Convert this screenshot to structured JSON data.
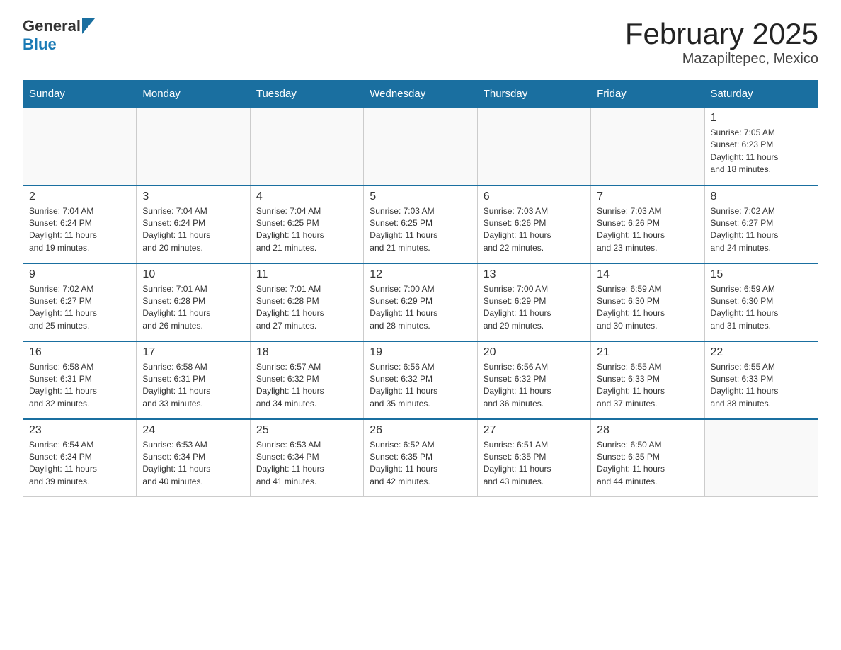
{
  "logo": {
    "general": "General",
    "blue": "Blue"
  },
  "title": "February 2025",
  "subtitle": "Mazapiltepec, Mexico",
  "days_of_week": [
    "Sunday",
    "Monday",
    "Tuesday",
    "Wednesday",
    "Thursday",
    "Friday",
    "Saturday"
  ],
  "weeks": [
    {
      "days": [
        {
          "number": "",
          "info": "",
          "empty": true
        },
        {
          "number": "",
          "info": "",
          "empty": true
        },
        {
          "number": "",
          "info": "",
          "empty": true
        },
        {
          "number": "",
          "info": "",
          "empty": true
        },
        {
          "number": "",
          "info": "",
          "empty": true
        },
        {
          "number": "",
          "info": "",
          "empty": true
        },
        {
          "number": "1",
          "info": "Sunrise: 7:05 AM\nSunset: 6:23 PM\nDaylight: 11 hours\nand 18 minutes.",
          "empty": false
        }
      ]
    },
    {
      "days": [
        {
          "number": "2",
          "info": "Sunrise: 7:04 AM\nSunset: 6:24 PM\nDaylight: 11 hours\nand 19 minutes.",
          "empty": false
        },
        {
          "number": "3",
          "info": "Sunrise: 7:04 AM\nSunset: 6:24 PM\nDaylight: 11 hours\nand 20 minutes.",
          "empty": false
        },
        {
          "number": "4",
          "info": "Sunrise: 7:04 AM\nSunset: 6:25 PM\nDaylight: 11 hours\nand 21 minutes.",
          "empty": false
        },
        {
          "number": "5",
          "info": "Sunrise: 7:03 AM\nSunset: 6:25 PM\nDaylight: 11 hours\nand 21 minutes.",
          "empty": false
        },
        {
          "number": "6",
          "info": "Sunrise: 7:03 AM\nSunset: 6:26 PM\nDaylight: 11 hours\nand 22 minutes.",
          "empty": false
        },
        {
          "number": "7",
          "info": "Sunrise: 7:03 AM\nSunset: 6:26 PM\nDaylight: 11 hours\nand 23 minutes.",
          "empty": false
        },
        {
          "number": "8",
          "info": "Sunrise: 7:02 AM\nSunset: 6:27 PM\nDaylight: 11 hours\nand 24 minutes.",
          "empty": false
        }
      ]
    },
    {
      "days": [
        {
          "number": "9",
          "info": "Sunrise: 7:02 AM\nSunset: 6:27 PM\nDaylight: 11 hours\nand 25 minutes.",
          "empty": false
        },
        {
          "number": "10",
          "info": "Sunrise: 7:01 AM\nSunset: 6:28 PM\nDaylight: 11 hours\nand 26 minutes.",
          "empty": false
        },
        {
          "number": "11",
          "info": "Sunrise: 7:01 AM\nSunset: 6:28 PM\nDaylight: 11 hours\nand 27 minutes.",
          "empty": false
        },
        {
          "number": "12",
          "info": "Sunrise: 7:00 AM\nSunset: 6:29 PM\nDaylight: 11 hours\nand 28 minutes.",
          "empty": false
        },
        {
          "number": "13",
          "info": "Sunrise: 7:00 AM\nSunset: 6:29 PM\nDaylight: 11 hours\nand 29 minutes.",
          "empty": false
        },
        {
          "number": "14",
          "info": "Sunrise: 6:59 AM\nSunset: 6:30 PM\nDaylight: 11 hours\nand 30 minutes.",
          "empty": false
        },
        {
          "number": "15",
          "info": "Sunrise: 6:59 AM\nSunset: 6:30 PM\nDaylight: 11 hours\nand 31 minutes.",
          "empty": false
        }
      ]
    },
    {
      "days": [
        {
          "number": "16",
          "info": "Sunrise: 6:58 AM\nSunset: 6:31 PM\nDaylight: 11 hours\nand 32 minutes.",
          "empty": false
        },
        {
          "number": "17",
          "info": "Sunrise: 6:58 AM\nSunset: 6:31 PM\nDaylight: 11 hours\nand 33 minutes.",
          "empty": false
        },
        {
          "number": "18",
          "info": "Sunrise: 6:57 AM\nSunset: 6:32 PM\nDaylight: 11 hours\nand 34 minutes.",
          "empty": false
        },
        {
          "number": "19",
          "info": "Sunrise: 6:56 AM\nSunset: 6:32 PM\nDaylight: 11 hours\nand 35 minutes.",
          "empty": false
        },
        {
          "number": "20",
          "info": "Sunrise: 6:56 AM\nSunset: 6:32 PM\nDaylight: 11 hours\nand 36 minutes.",
          "empty": false
        },
        {
          "number": "21",
          "info": "Sunrise: 6:55 AM\nSunset: 6:33 PM\nDaylight: 11 hours\nand 37 minutes.",
          "empty": false
        },
        {
          "number": "22",
          "info": "Sunrise: 6:55 AM\nSunset: 6:33 PM\nDaylight: 11 hours\nand 38 minutes.",
          "empty": false
        }
      ]
    },
    {
      "days": [
        {
          "number": "23",
          "info": "Sunrise: 6:54 AM\nSunset: 6:34 PM\nDaylight: 11 hours\nand 39 minutes.",
          "empty": false
        },
        {
          "number": "24",
          "info": "Sunrise: 6:53 AM\nSunset: 6:34 PM\nDaylight: 11 hours\nand 40 minutes.",
          "empty": false
        },
        {
          "number": "25",
          "info": "Sunrise: 6:53 AM\nSunset: 6:34 PM\nDaylight: 11 hours\nand 41 minutes.",
          "empty": false
        },
        {
          "number": "26",
          "info": "Sunrise: 6:52 AM\nSunset: 6:35 PM\nDaylight: 11 hours\nand 42 minutes.",
          "empty": false
        },
        {
          "number": "27",
          "info": "Sunrise: 6:51 AM\nSunset: 6:35 PM\nDaylight: 11 hours\nand 43 minutes.",
          "empty": false
        },
        {
          "number": "28",
          "info": "Sunrise: 6:50 AM\nSunset: 6:35 PM\nDaylight: 11 hours\nand 44 minutes.",
          "empty": false
        },
        {
          "number": "",
          "info": "",
          "empty": true
        }
      ]
    }
  ]
}
